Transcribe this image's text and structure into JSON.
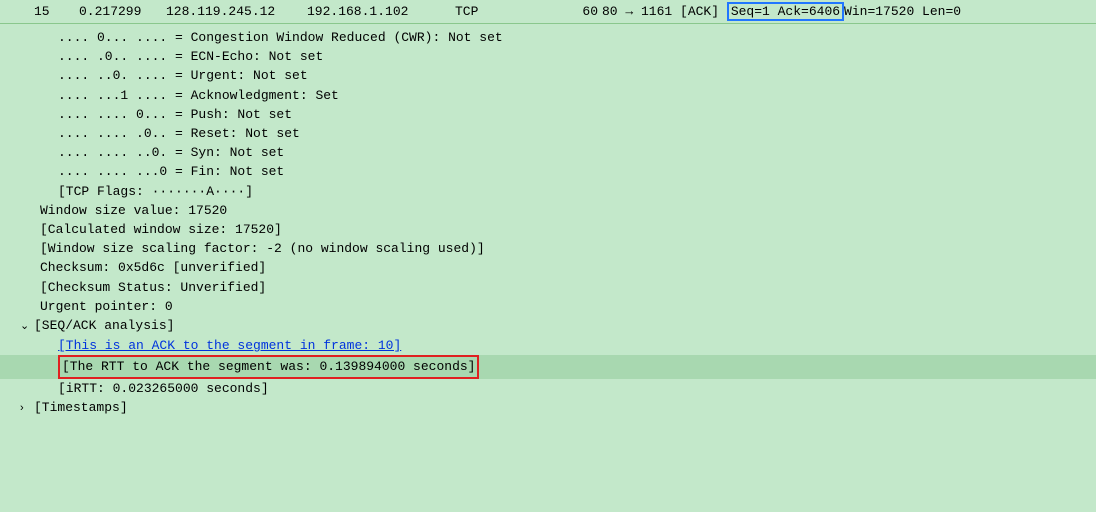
{
  "packet_row": {
    "no": "15",
    "time": "0.217299",
    "source": "128.119.245.12",
    "destination": "192.168.1.102",
    "protocol": "TCP",
    "length": "60",
    "info_prefix": "80 → 1161 [ACK] ",
    "info_highlighted": "Seq=1 Ack=6406 ",
    "info_suffix": "Win=17520 Len=0"
  },
  "flags": {
    "cwr": ".... 0... .... = Congestion Window Reduced (CWR): Not set",
    "ecn": ".... .0.. .... = ECN-Echo: Not set",
    "urg": ".... ..0. .... = Urgent: Not set",
    "ack": ".... ...1 .... = Acknowledgment: Set",
    "push": ".... .... 0... = Push: Not set",
    "reset": ".... .... .0.. = Reset: Not set",
    "syn": ".... .... ..0. = Syn: Not set",
    "fin": ".... .... ...0 = Fin: Not set",
    "summary": "[TCP Flags: ·······A····]"
  },
  "window": {
    "size_value": "Window size value: 17520",
    "calc_size": "[Calculated window size: 17520]",
    "scaling": "[Window size scaling factor: -2 (no window scaling used)]"
  },
  "checksum": {
    "value": "Checksum: 0x5d6c [unverified]",
    "status": "[Checksum Status: Unverified]"
  },
  "urgent_pointer": "Urgent pointer: 0",
  "seq_ack": {
    "header": "[SEQ/ACK analysis]",
    "ack_to": "[This is an ACK to the segment in frame: 10]",
    "rtt": "[The RTT to ACK the segment was: 0.139894000 seconds]",
    "irtt": "[iRTT: 0.023265000 seconds]"
  },
  "timestamps": {
    "header": "[Timestamps]"
  }
}
